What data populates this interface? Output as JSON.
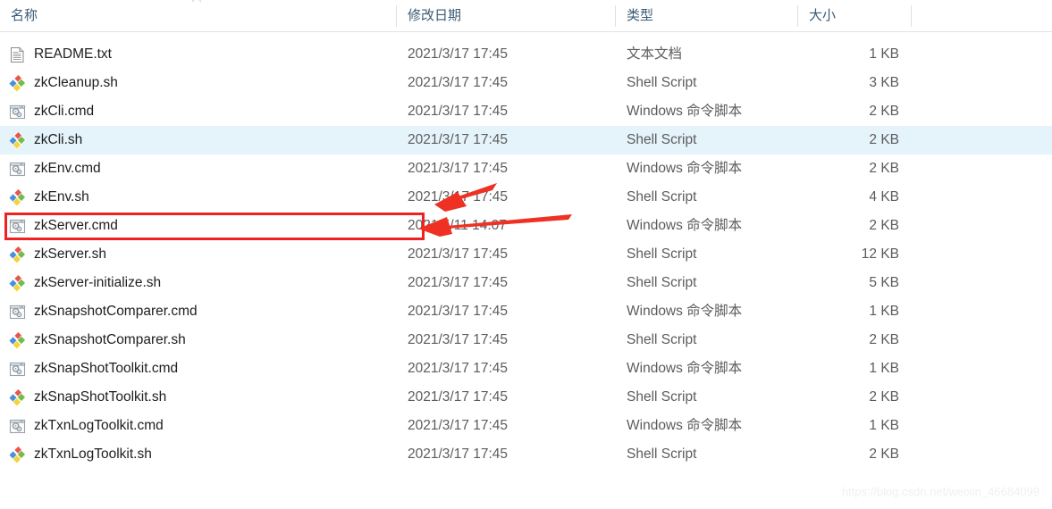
{
  "window": {
    "app": "Windows File Explorer",
    "view": "details-list"
  },
  "columns": {
    "name": "名称",
    "date": "修改日期",
    "type": "类型",
    "size": "大小"
  },
  "colors": {
    "selection_highlight": "#e5f3fb",
    "annotation_red": "#ee2222",
    "header_text": "#3b5b75",
    "secondary_text": "#5c5c5c"
  },
  "annotations": {
    "highlight_box_target": "zkServer.cmd",
    "arrow_count": 2
  },
  "watermark": "https://blog.csdn.net/weixin_46684099",
  "files": [
    {
      "name": "README.txt",
      "date": "2021/3/17 17:45",
      "type": "文本文档",
      "size": "1 KB",
      "icon": "text-document-icon",
      "selected": false,
      "annotated": false
    },
    {
      "name": "zkCleanup.sh",
      "date": "2021/3/17 17:45",
      "type": "Shell Script",
      "size": "3 KB",
      "icon": "shell-script-icon",
      "selected": false,
      "annotated": false
    },
    {
      "name": "zkCli.cmd",
      "date": "2021/3/17 17:45",
      "type": "Windows 命令脚本",
      "size": "2 KB",
      "icon": "cmd-script-icon",
      "selected": false,
      "annotated": false
    },
    {
      "name": "zkCli.sh",
      "date": "2021/3/17 17:45",
      "type": "Shell Script",
      "size": "2 KB",
      "icon": "shell-script-icon",
      "selected": true,
      "annotated": false
    },
    {
      "name": "zkEnv.cmd",
      "date": "2021/3/17 17:45",
      "type": "Windows 命令脚本",
      "size": "2 KB",
      "icon": "cmd-script-icon",
      "selected": false,
      "annotated": false
    },
    {
      "name": "zkEnv.sh",
      "date": "2021/3/17 17:45",
      "type": "Shell Script",
      "size": "4 KB",
      "icon": "shell-script-icon",
      "selected": false,
      "annotated": false
    },
    {
      "name": "zkServer.cmd",
      "date": "2021/5/11 14:07",
      "type": "Windows 命令脚本",
      "size": "2 KB",
      "icon": "cmd-script-icon",
      "selected": false,
      "annotated": true
    },
    {
      "name": "zkServer.sh",
      "date": "2021/3/17 17:45",
      "type": "Shell Script",
      "size": "12 KB",
      "icon": "shell-script-icon",
      "selected": false,
      "annotated": false
    },
    {
      "name": "zkServer-initialize.sh",
      "date": "2021/3/17 17:45",
      "type": "Shell Script",
      "size": "5 KB",
      "icon": "shell-script-icon",
      "selected": false,
      "annotated": false
    },
    {
      "name": "zkSnapshotComparer.cmd",
      "date": "2021/3/17 17:45",
      "type": "Windows 命令脚本",
      "size": "1 KB",
      "icon": "cmd-script-icon",
      "selected": false,
      "annotated": false
    },
    {
      "name": "zkSnapshotComparer.sh",
      "date": "2021/3/17 17:45",
      "type": "Shell Script",
      "size": "2 KB",
      "icon": "shell-script-icon",
      "selected": false,
      "annotated": false
    },
    {
      "name": "zkSnapShotToolkit.cmd",
      "date": "2021/3/17 17:45",
      "type": "Windows 命令脚本",
      "size": "1 KB",
      "icon": "cmd-script-icon",
      "selected": false,
      "annotated": false
    },
    {
      "name": "zkSnapShotToolkit.sh",
      "date": "2021/3/17 17:45",
      "type": "Shell Script",
      "size": "2 KB",
      "icon": "shell-script-icon",
      "selected": false,
      "annotated": false
    },
    {
      "name": "zkTxnLogToolkit.cmd",
      "date": "2021/3/17 17:45",
      "type": "Windows 命令脚本",
      "size": "1 KB",
      "icon": "cmd-script-icon",
      "selected": false,
      "annotated": false
    },
    {
      "name": "zkTxnLogToolkit.sh",
      "date": "2021/3/17 17:45",
      "type": "Shell Script",
      "size": "2 KB",
      "icon": "shell-script-icon",
      "selected": false,
      "annotated": false
    }
  ]
}
